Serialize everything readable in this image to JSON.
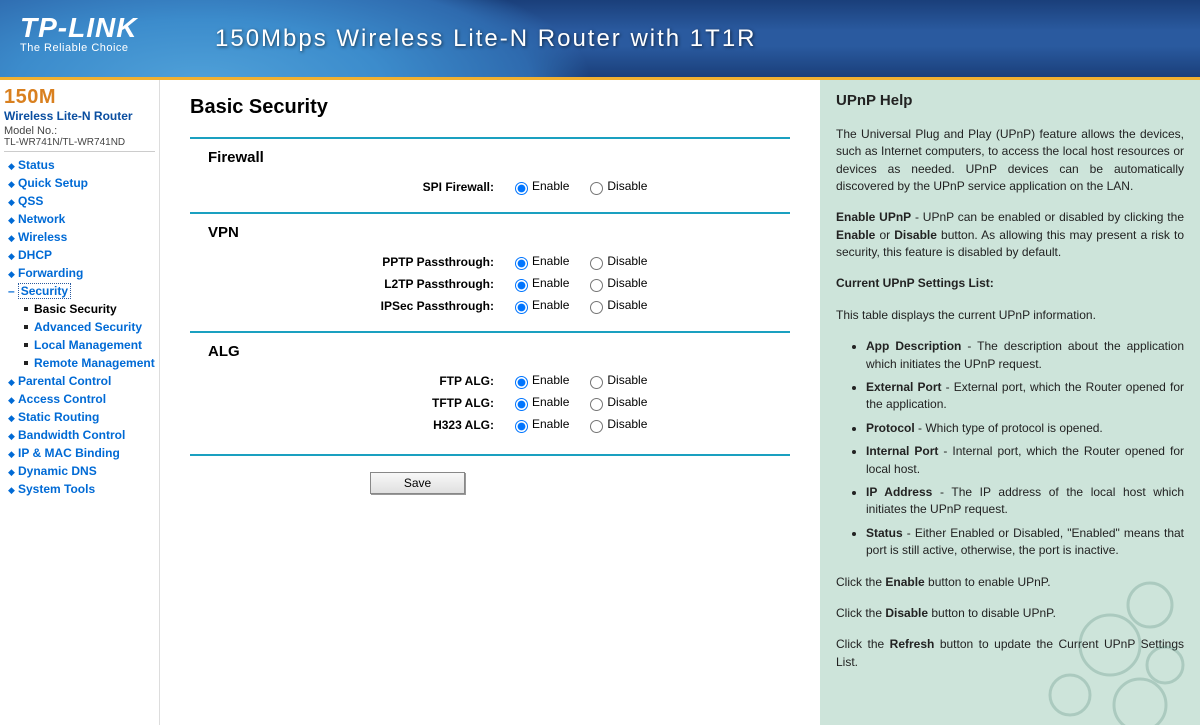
{
  "brand": {
    "name": "TP-LINK",
    "tag": "The Reliable Choice"
  },
  "header_title": "150Mbps Wireless Lite-N Router with 1T1R",
  "sidebar_header": {
    "line1": "150M",
    "line2": "Wireless Lite-N Router",
    "model_label": "Model No.:",
    "model": "TL-WR741N/TL-WR741ND"
  },
  "nav": [
    {
      "label": "Status"
    },
    {
      "label": "Quick Setup"
    },
    {
      "label": "QSS"
    },
    {
      "label": "Network"
    },
    {
      "label": "Wireless"
    },
    {
      "label": "DHCP"
    },
    {
      "label": "Forwarding"
    },
    {
      "label": "Security",
      "expanded": true,
      "children": [
        {
          "label": "Basic Security",
          "active": true
        },
        {
          "label": "Advanced Security"
        },
        {
          "label": "Local Management"
        },
        {
          "label": "Remote Management"
        }
      ]
    },
    {
      "label": "Parental Control"
    },
    {
      "label": "Access Control"
    },
    {
      "label": "Static Routing"
    },
    {
      "label": "Bandwidth Control"
    },
    {
      "label": "IP & MAC Binding"
    },
    {
      "label": "Dynamic DNS"
    },
    {
      "label": "System Tools"
    }
  ],
  "page_title": "Basic Security",
  "option_labels": {
    "enable": "Enable",
    "disable": "Disable"
  },
  "sections": {
    "firewall": {
      "title": "Firewall",
      "rows": [
        {
          "label": "SPI Firewall:",
          "value": "enable"
        }
      ]
    },
    "vpn": {
      "title": "VPN",
      "rows": [
        {
          "label": "PPTP Passthrough:",
          "value": "enable"
        },
        {
          "label": "L2TP Passthrough:",
          "value": "enable"
        },
        {
          "label": "IPSec Passthrough:",
          "value": "enable"
        }
      ]
    },
    "alg": {
      "title": "ALG",
      "rows": [
        {
          "label": "FTP ALG:",
          "value": "enable"
        },
        {
          "label": "TFTP ALG:",
          "value": "enable"
        },
        {
          "label": "H323 ALG:",
          "value": "enable"
        }
      ]
    }
  },
  "save_label": "Save",
  "help": {
    "title": "UPnP Help",
    "intro": "The Universal Plug and Play (UPnP) feature allows the devices, such as Internet computers, to access the local host resources or devices as needed. UPnP devices can be automatically discovered by the UPnP service application on the LAN.",
    "enable_label": "Enable UPnP",
    "enable_text": " - UPnP can be enabled or disabled by clicking the ",
    "enable_word": "Enable",
    "or_word": " or ",
    "disable_word": "Disable",
    "enable_tail": " button. As allowing this may present a risk to security, this feature is disabled by default.",
    "settings_list_label": "Current UPnP Settings List:",
    "settings_list_intro": "This table displays the current UPnP information.",
    "bullets": [
      {
        "term": "App Description",
        "text": " - The description about the application which initiates the UPnP request."
      },
      {
        "term": "External Port",
        "text": " - External port, which the Router opened for the application."
      },
      {
        "term": "Protocol",
        "text": " - Which type of protocol is opened."
      },
      {
        "term": "Internal Port",
        "text": " - Internal port, which the Router opened for local host."
      },
      {
        "term": "IP Address",
        "text": " - The IP address of the local host which initiates the UPnP request."
      },
      {
        "term": "Status",
        "text": " - Either Enabled or Disabled, \"Enabled\" means that port is still active, otherwise, the port is inactive."
      }
    ],
    "foot1_a": "Click the ",
    "foot1_b": "Enable",
    "foot1_c": " button to enable UPnP.",
    "foot2_a": "Click the ",
    "foot2_b": "Disable",
    "foot2_c": " button to disable UPnP.",
    "foot3_a": "Click the ",
    "foot3_b": "Refresh",
    "foot3_c": " button to update the Current UPnP Settings List."
  }
}
